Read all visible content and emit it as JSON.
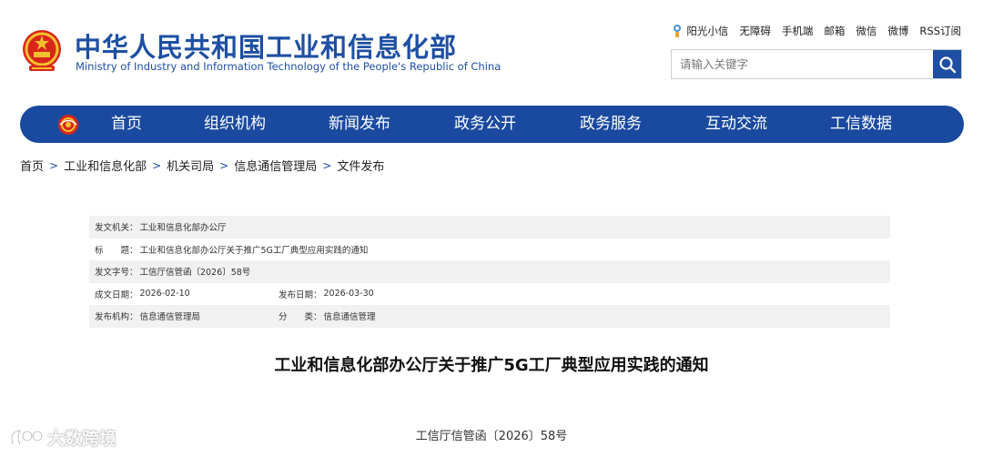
{
  "header": {
    "site_title": "中华人民共和国工业和信息化部",
    "site_subtitle": "Ministry of Industry and Information Technology of the People's Republic of China",
    "emblem_icon": "national-emblem-icon",
    "top_links": [
      "阳光小信",
      "无障碍",
      "手机端",
      "邮箱",
      "微信",
      "微博",
      "RSS订阅"
    ],
    "search": {
      "placeholder": "请输入关键字",
      "icon": "search-icon"
    }
  },
  "colors": {
    "brand_blue": "#1a4a9f",
    "text": "#333333",
    "shade": "#f1f1f1"
  },
  "nav": {
    "logo_icon": "miit-logo-icon",
    "items": [
      "首页",
      "组织机构",
      "新闻发布",
      "政务公开",
      "政务服务",
      "互动交流",
      "工信数据"
    ]
  },
  "breadcrumb": [
    "首页",
    "工业和信息化部",
    "机关司局",
    "信息通信管理局",
    "文件发布"
  ],
  "info": {
    "issuer_label": "发文机关：",
    "issuer": "工业和信息化部办公厅",
    "title_label": "标　　题：",
    "title": "工业和信息化部办公厅关于推广5G工厂典型应用实践的通知",
    "doc_no_label": "发文字号：",
    "doc_no": "工信厅信管函〔2026〕58号",
    "created_label": "成文日期：",
    "created": "2026-02-10",
    "published_label": "发布日期：",
    "published": "2026-03-30",
    "org_label": "发布机构：",
    "org": "信息通信管理局",
    "category_label": "分　　类：",
    "category": "信息通信管理"
  },
  "document": {
    "heading": "工业和信息化部办公厅关于推广5G工厂典型应用实践的通知",
    "number": "工信厅信管函〔2026〕58号"
  },
  "watermark": {
    "text": "大数跨境"
  }
}
